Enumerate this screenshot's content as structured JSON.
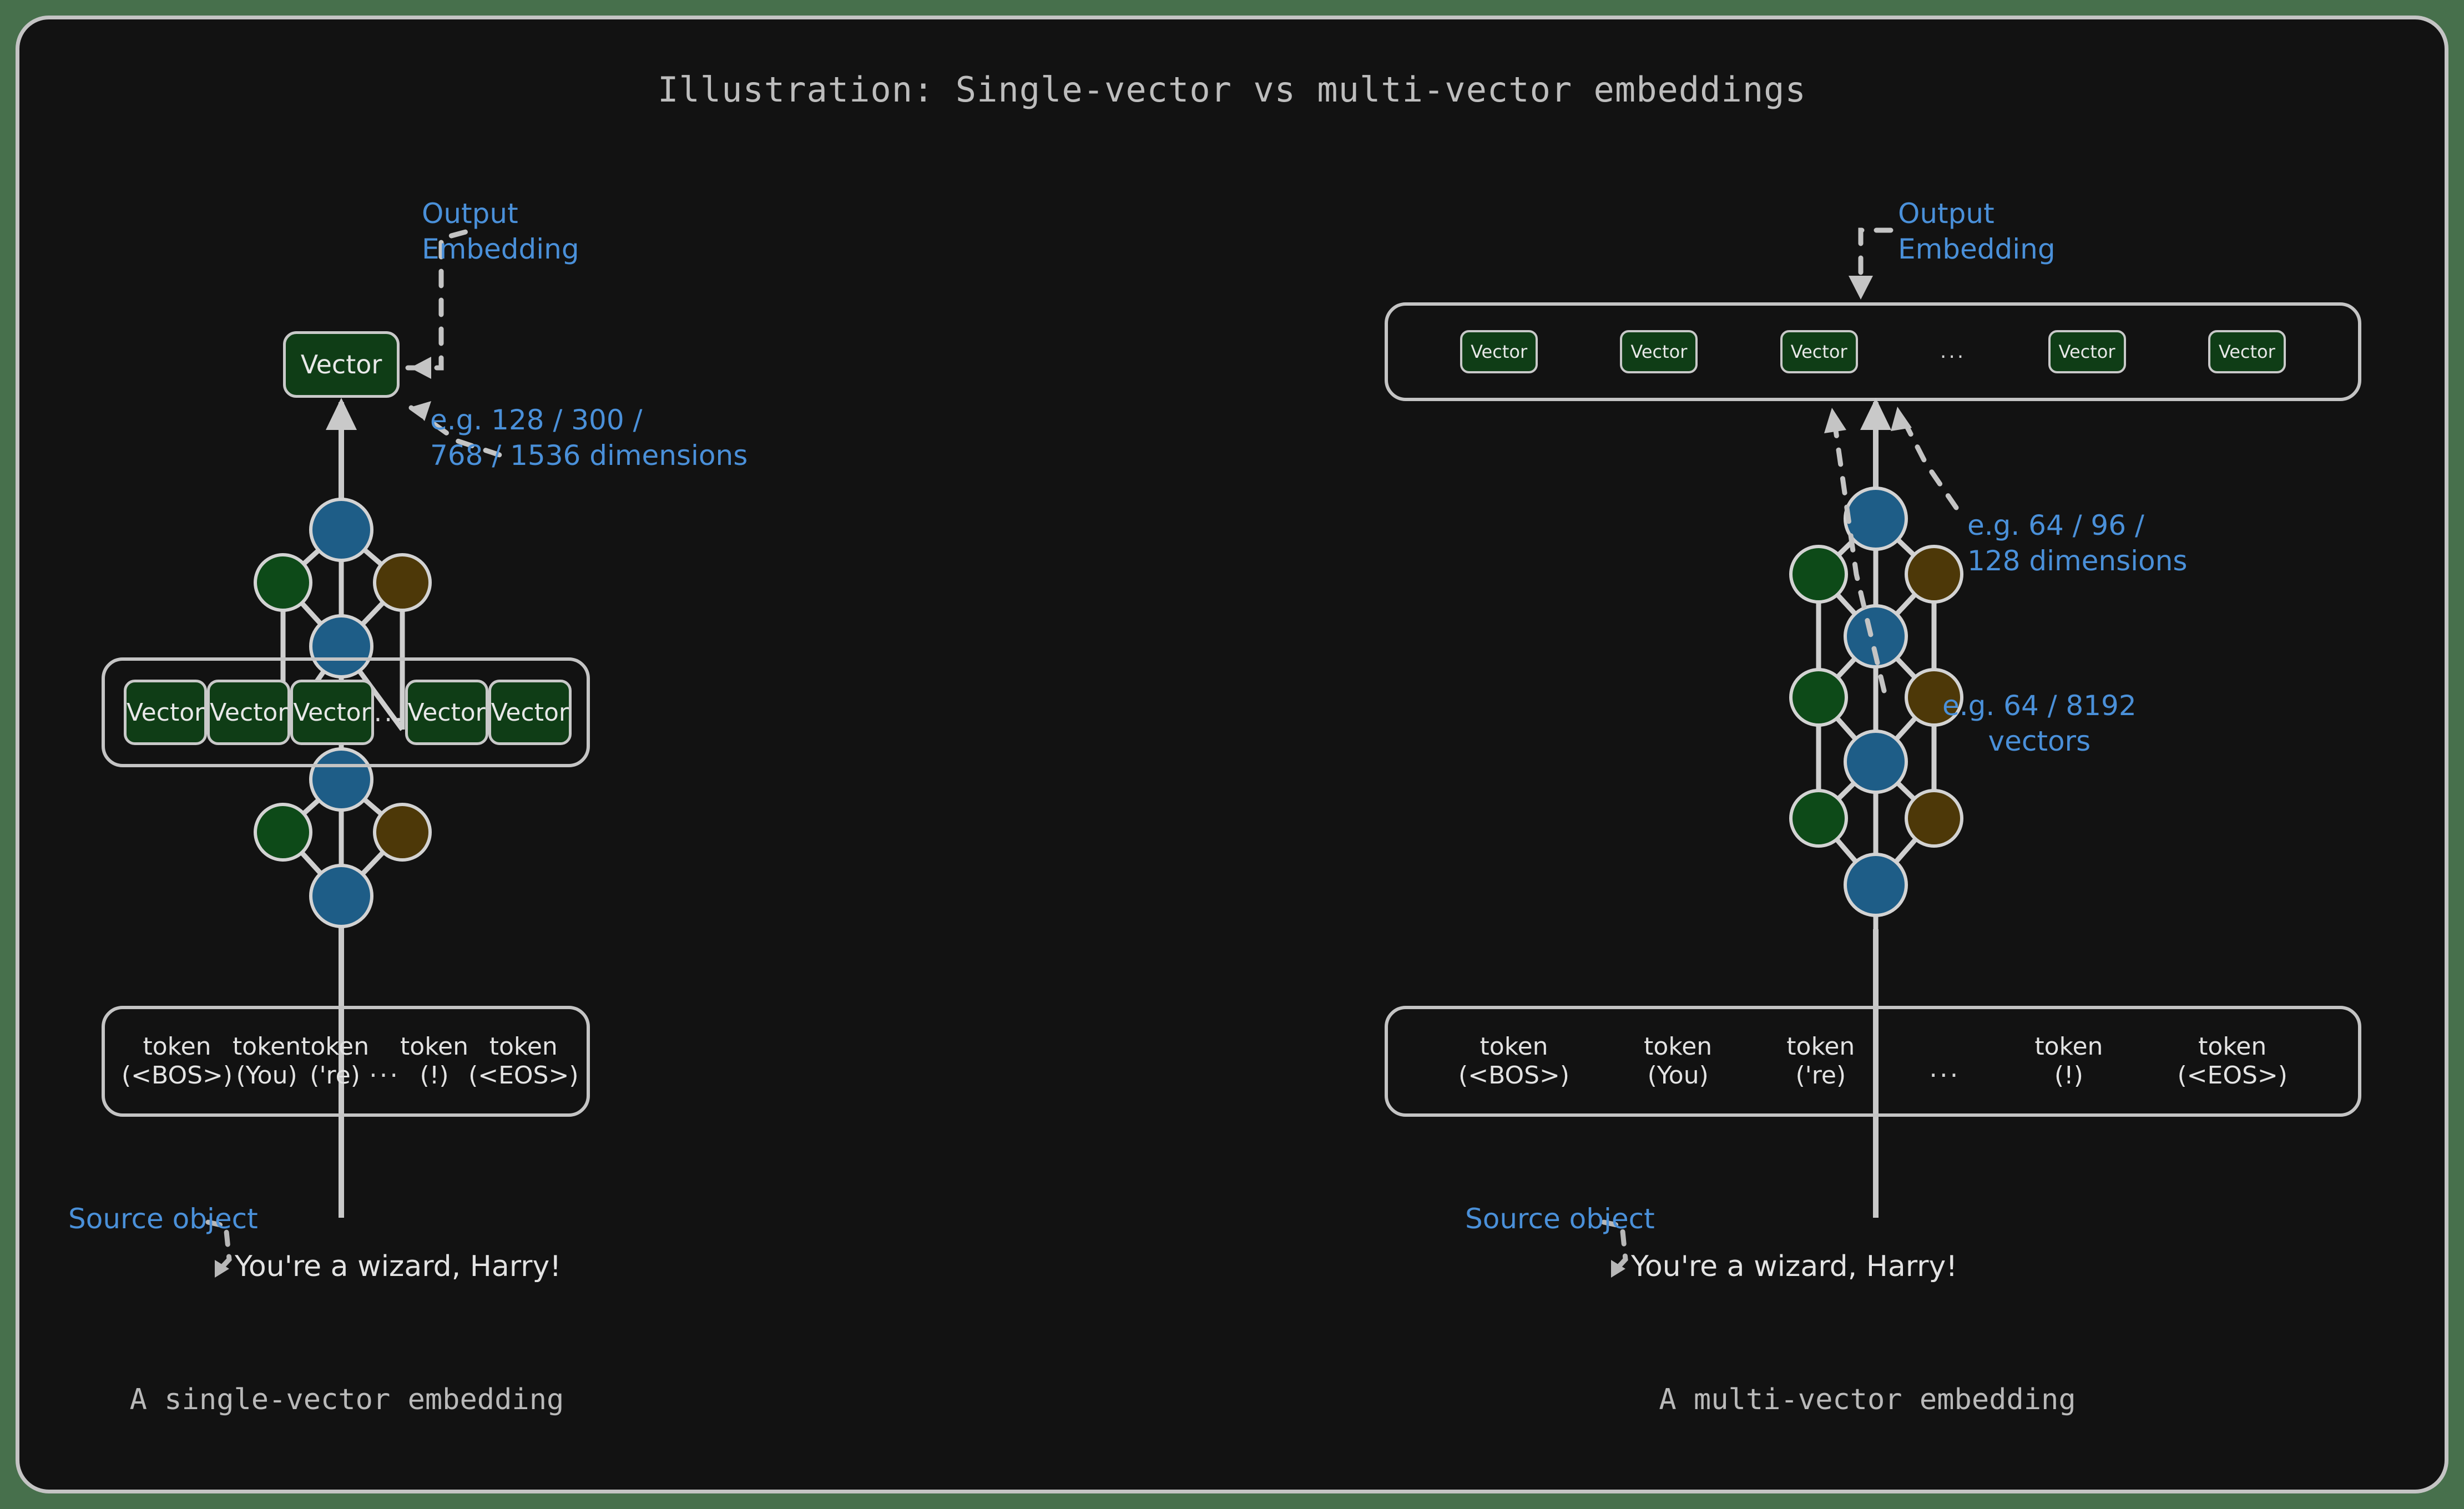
{
  "figure": {
    "title": "Illustration: Single-vector vs multi-vector embeddings",
    "background_color": "#121212",
    "frame_color": "#47704c",
    "border_color": "#c4c4c4"
  },
  "palette": {
    "accent_blue": "#4a90d9",
    "vector_fill": "#0f3d16",
    "node_blue": "#1e5d87",
    "node_green": "#0d4a18",
    "node_brown": "#4d3808",
    "stroke": "#c9c9c9",
    "text": "#e3e3e3"
  },
  "panels": [
    {
      "id": "single-vector",
      "caption": "A single-vector embedding",
      "output": {
        "label": "Vector",
        "annotation_label": "Output\nEmbedding",
        "annotation_dims": "e.g. 128 / 300 /\n768 / 1536 dimensions"
      },
      "vector_row": {
        "items": [
          "Vector",
          "Vector",
          "Vector",
          "Vector",
          "Vector"
        ],
        "ellipsis": "...",
        "ellipsis_after_index": 3
      },
      "tokens": [
        {
          "line1": "token",
          "line2": "(<BOS>)"
        },
        {
          "line1": "token",
          "line2": "(You)"
        },
        {
          "line1": "token",
          "line2": "('re)"
        },
        {
          "line1": "token",
          "line2": "(!)"
        },
        {
          "line1": "token",
          "line2": "(<EOS>)"
        }
      ],
      "tokens_ellipsis": "...",
      "tokens_ellipsis_after_index": 3,
      "source": {
        "label": "Source object",
        "text": "You're a wizard, Harry!"
      }
    },
    {
      "id": "multi-vector",
      "caption": "A multi-vector embedding",
      "output": {
        "annotation_label": "Output\nEmbedding",
        "annotation_dims": "e.g. 64 / 96 /\n128 dimensions",
        "annotation_count": "e.g. 64 / 8192\nvectors"
      },
      "vector_row": {
        "items": [
          "Vector",
          "Vector",
          "Vector",
          "Vector",
          "Vector"
        ],
        "ellipsis": "...",
        "ellipsis_after_index": 3
      },
      "tokens": [
        {
          "line1": "token",
          "line2": "(<BOS>)"
        },
        {
          "line1": "token",
          "line2": "(You)"
        },
        {
          "line1": "token",
          "line2": "('re)"
        },
        {
          "line1": "token",
          "line2": "(!)"
        },
        {
          "line1": "token",
          "line2": "(<EOS>)"
        }
      ],
      "tokens_ellipsis": "...",
      "tokens_ellipsis_after_index": 3,
      "source": {
        "label": "Source object",
        "text": "You're a wizard, Harry!"
      }
    }
  ]
}
